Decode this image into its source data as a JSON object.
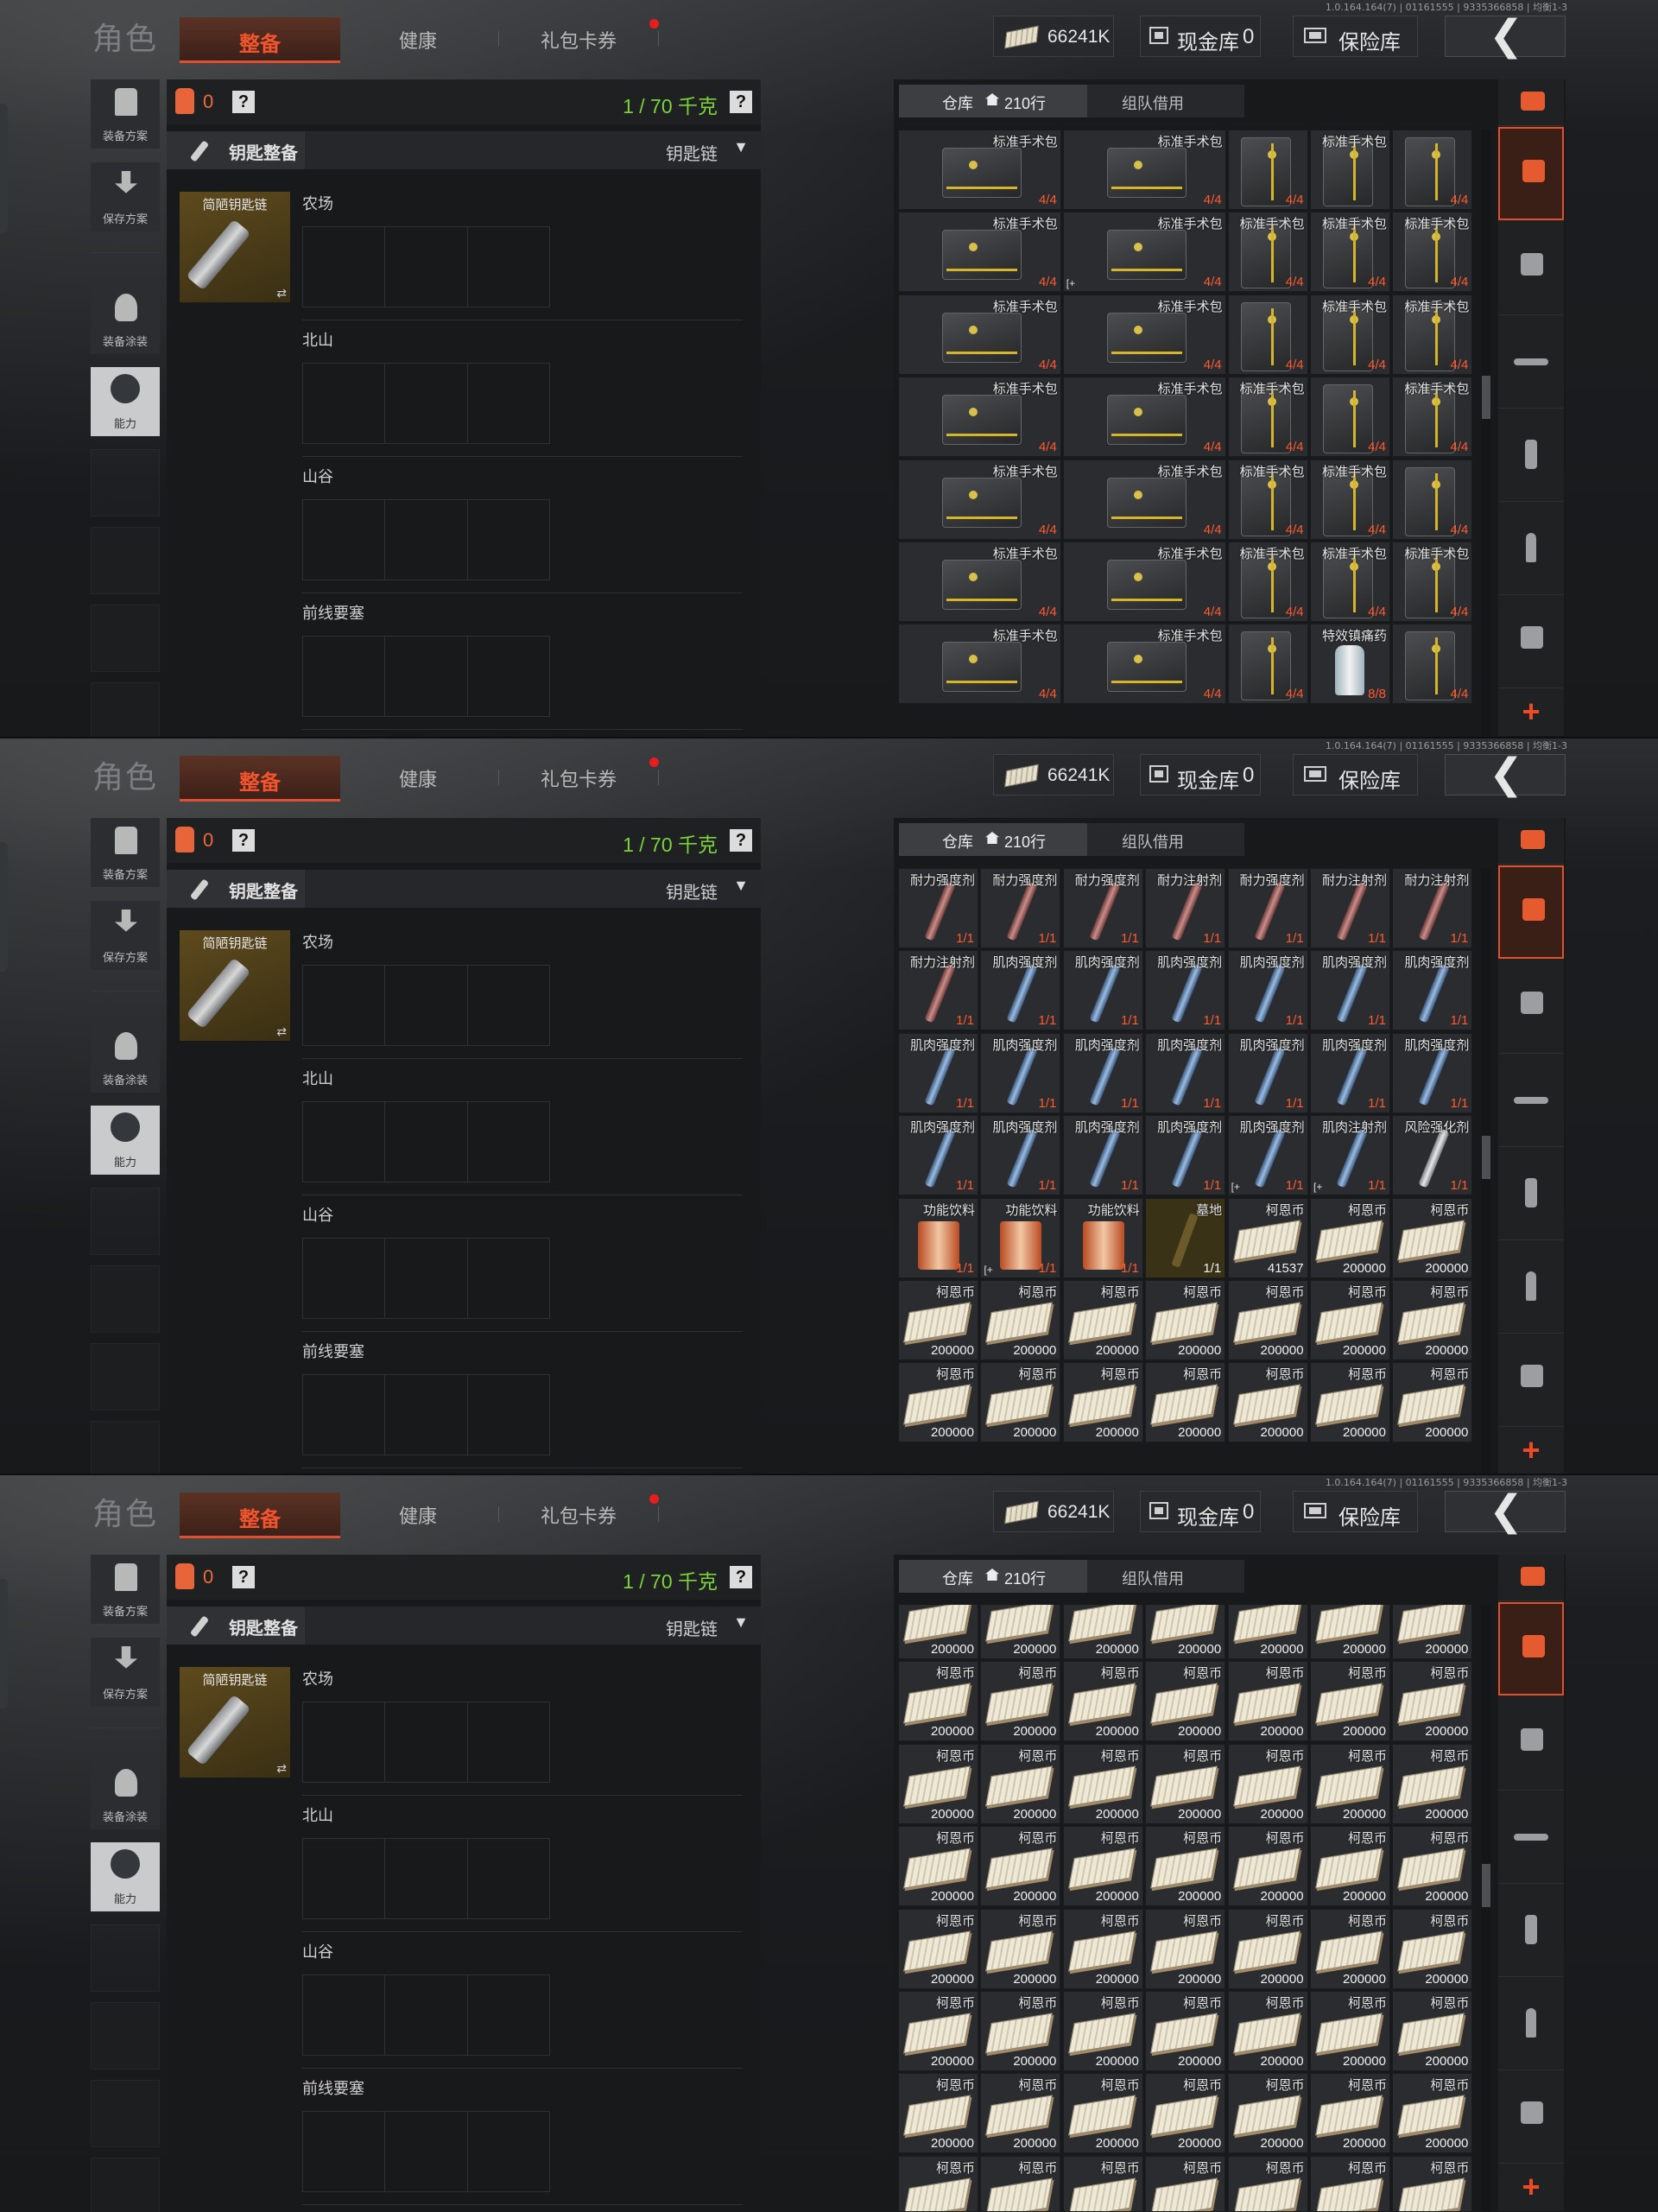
{
  "version": "1.0.164.164(7) | 01161555 | 9335366858 | 均衡1-3",
  "title": "角色",
  "tabs": {
    "active": "整备",
    "health": "健康",
    "gift": "礼包卡券"
  },
  "currency": {
    "amount": "66241K",
    "cash_vault_label": "现金库",
    "cash_vault_value": "0",
    "safe_label": "保险库"
  },
  "side": {
    "plan": "装备方案",
    "save": "保存方案",
    "paint": "装备涂装",
    "ability": "能力"
  },
  "panel": {
    "count": "0",
    "qmark": "?",
    "weight": "1 / 70 千克",
    "key_title": "钥匙整备",
    "key_select": "钥匙链",
    "keychain_name": "简陋钥匙链",
    "swap": "⇄",
    "sections": [
      "农场",
      "北山",
      "山谷",
      "前线要塞"
    ]
  },
  "inventory": {
    "tab_warehouse": "仓库",
    "rows": "210行",
    "tab_team": "组队借用",
    "plus": "+"
  },
  "screens": [
    {
      "grid": [
        [
          {
            "kind": "bag",
            "name": "标准手术包",
            "count": "4/4"
          },
          {
            "kind": "bag",
            "name": "标准手术包",
            "count": "4/4"
          },
          {
            "kind": "bagv",
            "name": "",
            "count": "4/4"
          },
          {
            "kind": "bagv",
            "name": "标准手术包",
            "count": ""
          },
          {
            "kind": "bagv",
            "name": "",
            "count": "4/4"
          }
        ],
        [
          {
            "kind": "bag",
            "name": "标准手术包",
            "count": "4/4"
          },
          {
            "kind": "bag",
            "name": "标准手术包",
            "count": "4/4",
            "mark": "[+"
          },
          {
            "kind": "bagv",
            "name": "标准手术包",
            "count": "4/4"
          },
          {
            "kind": "bagv",
            "name": "标准手术包",
            "count": "4/4"
          },
          {
            "kind": "bagv",
            "name": "标准手术包",
            "count": "4/4"
          }
        ],
        [
          {
            "kind": "bag",
            "name": "标准手术包",
            "count": "4/4"
          },
          {
            "kind": "bag",
            "name": "标准手术包",
            "count": "4/4"
          },
          {
            "kind": "bagv",
            "name": "",
            "count": "4/4"
          },
          {
            "kind": "bagv",
            "name": "标准手术包",
            "count": "4/4"
          },
          {
            "kind": "bagv",
            "name": "标准手术包",
            "count": "4/4"
          }
        ],
        [
          {
            "kind": "bag",
            "name": "标准手术包",
            "count": "4/4"
          },
          {
            "kind": "bag",
            "name": "标准手术包",
            "count": "4/4"
          },
          {
            "kind": "bagv",
            "name": "标准手术包",
            "count": "4/4"
          },
          {
            "kind": "bagv",
            "name": "",
            "count": "4/4"
          },
          {
            "kind": "bagv",
            "name": "标准手术包",
            "count": "4/4"
          }
        ],
        [
          {
            "kind": "bag",
            "name": "标准手术包",
            "count": "4/4"
          },
          {
            "kind": "bag",
            "name": "标准手术包",
            "count": "4/4"
          },
          {
            "kind": "bagv",
            "name": "标准手术包",
            "count": "4/4"
          },
          {
            "kind": "bagv",
            "name": "标准手术包",
            "count": "4/4"
          },
          {
            "kind": "bagv",
            "name": "",
            "count": "4/4"
          }
        ],
        [
          {
            "kind": "bag",
            "name": "标准手术包",
            "count": "4/4"
          },
          {
            "kind": "bag",
            "name": "标准手术包",
            "count": "4/4"
          },
          {
            "kind": "bagv",
            "name": "标准手术包",
            "count": "4/4"
          },
          {
            "kind": "bagv",
            "name": "标准手术包",
            "count": "4/4"
          },
          {
            "kind": "bagv",
            "name": "标准手术包",
            "count": "4/4"
          }
        ],
        [
          {
            "kind": "bag",
            "name": "标准手术包",
            "count": "4/4"
          },
          {
            "kind": "bag",
            "name": "标准手术包",
            "count": "4/4"
          },
          {
            "kind": "bagv",
            "name": "",
            "count": "4/4"
          },
          {
            "kind": "bottle",
            "name": "特效镇痛药",
            "count": "8/8"
          },
          {
            "kind": "bagv",
            "name": "",
            "count": "4/4"
          }
        ]
      ]
    },
    {
      "grid": [
        [
          {
            "kind": "syr-red",
            "name": "耐力强度剂",
            "count": "1/1"
          },
          {
            "kind": "syr-red",
            "name": "耐力强度剂",
            "count": "1/1"
          },
          {
            "kind": "syr-red",
            "name": "耐力强度剂",
            "count": "1/1"
          },
          {
            "kind": "syr-red",
            "name": "耐力注射剂",
            "count": "1/1"
          },
          {
            "kind": "syr-red",
            "name": "耐力强度剂",
            "count": "1/1"
          },
          {
            "kind": "syr-red",
            "name": "耐力注射剂",
            "count": "1/1"
          },
          {
            "kind": "syr-red",
            "name": "耐力注射剂",
            "count": "1/1"
          }
        ],
        [
          {
            "kind": "syr-red",
            "name": "耐力注射剂",
            "count": "1/1"
          },
          {
            "kind": "syr-blue",
            "name": "肌肉强度剂",
            "count": "1/1"
          },
          {
            "kind": "syr-blue",
            "name": "肌肉强度剂",
            "count": "1/1"
          },
          {
            "kind": "syr-blue",
            "name": "肌肉强度剂",
            "count": "1/1"
          },
          {
            "kind": "syr-blue",
            "name": "肌肉强度剂",
            "count": "1/1"
          },
          {
            "kind": "syr-blue",
            "name": "肌肉强度剂",
            "count": "1/1"
          },
          {
            "kind": "syr-blue",
            "name": "肌肉强度剂",
            "count": "1/1"
          }
        ],
        [
          {
            "kind": "syr-blue",
            "name": "肌肉强度剂",
            "count": "1/1"
          },
          {
            "kind": "syr-blue",
            "name": "肌肉强度剂",
            "count": "1/1"
          },
          {
            "kind": "syr-blue",
            "name": "肌肉强度剂",
            "count": "1/1"
          },
          {
            "kind": "syr-blue",
            "name": "肌肉强度剂",
            "count": "1/1"
          },
          {
            "kind": "syr-blue",
            "name": "肌肉强度剂",
            "count": "1/1"
          },
          {
            "kind": "syr-blue",
            "name": "肌肉强度剂",
            "count": "1/1"
          },
          {
            "kind": "syr-blue",
            "name": "肌肉强度剂",
            "count": "1/1"
          }
        ],
        [
          {
            "kind": "syr-blue",
            "name": "肌肉强度剂",
            "count": "1/1"
          },
          {
            "kind": "syr-blue",
            "name": "肌肉强度剂",
            "count": "1/1"
          },
          {
            "kind": "syr-blue",
            "name": "肌肉强度剂",
            "count": "1/1"
          },
          {
            "kind": "syr-blue",
            "name": "肌肉强度剂",
            "count": "1/1"
          },
          {
            "kind": "syr-blue",
            "name": "肌肉强度剂",
            "count": "1/1",
            "mark": "[+"
          },
          {
            "kind": "syr-blue",
            "name": "肌肉注射剂",
            "count": "1/1",
            "mark": "[+"
          },
          {
            "kind": "syr-silver",
            "name": "风险强化剂",
            "count": "1/1"
          }
        ],
        [
          {
            "kind": "can",
            "name": "功能饮料",
            "count": "1/1"
          },
          {
            "kind": "can",
            "name": "功能饮料",
            "count": "1/1",
            "mark": "[+"
          },
          {
            "kind": "can",
            "name": "功能饮料",
            "count": "1/1"
          },
          {
            "kind": "shovel",
            "name": "墓地",
            "count": "1/1",
            "white": true,
            "gold": true
          },
          {
            "kind": "cash",
            "name": "柯恩币",
            "count": "41537",
            "white": true
          },
          {
            "kind": "cash",
            "name": "柯恩币",
            "count": "200000",
            "white": true
          },
          {
            "kind": "cash",
            "name": "柯恩币",
            "count": "200000",
            "white": true
          }
        ],
        [
          {
            "kind": "cash",
            "name": "柯恩币",
            "count": "200000",
            "white": true
          },
          {
            "kind": "cash",
            "name": "柯恩币",
            "count": "200000",
            "white": true
          },
          {
            "kind": "cash",
            "name": "柯恩币",
            "count": "200000",
            "white": true
          },
          {
            "kind": "cash",
            "name": "柯恩币",
            "count": "200000",
            "white": true
          },
          {
            "kind": "cash",
            "name": "柯恩币",
            "count": "200000",
            "white": true
          },
          {
            "kind": "cash",
            "name": "柯恩币",
            "count": "200000",
            "white": true
          },
          {
            "kind": "cash",
            "name": "柯恩币",
            "count": "200000",
            "white": true
          }
        ],
        [
          {
            "kind": "cash",
            "name": "柯恩币",
            "count": "200000",
            "white": true
          },
          {
            "kind": "cash",
            "name": "柯恩币",
            "count": "200000",
            "white": true
          },
          {
            "kind": "cash",
            "name": "柯恩币",
            "count": "200000",
            "white": true
          },
          {
            "kind": "cash",
            "name": "柯恩币",
            "count": "200000",
            "white": true
          },
          {
            "kind": "cash",
            "name": "柯恩币",
            "count": "200000",
            "white": true
          },
          {
            "kind": "cash",
            "name": "柯恩币",
            "count": "200000",
            "white": true
          },
          {
            "kind": "cash",
            "name": "柯恩币",
            "count": "200000",
            "white": true
          }
        ]
      ]
    },
    {
      "grid": [
        [
          {
            "kind": "cash",
            "name": "",
            "count": "200000",
            "white": true
          },
          {
            "kind": "cash",
            "name": "",
            "count": "200000",
            "white": true
          },
          {
            "kind": "cash",
            "name": "",
            "count": "200000",
            "white": true
          },
          {
            "kind": "cash",
            "name": "",
            "count": "200000",
            "white": true
          },
          {
            "kind": "cash",
            "name": "",
            "count": "200000",
            "white": true
          },
          {
            "kind": "cash",
            "name": "",
            "count": "200000",
            "white": true
          },
          {
            "kind": "cash",
            "name": "",
            "count": "200000",
            "white": true
          }
        ],
        [
          {
            "kind": "cash",
            "name": "柯恩币",
            "count": "200000",
            "white": true
          },
          {
            "kind": "cash",
            "name": "柯恩币",
            "count": "200000",
            "white": true
          },
          {
            "kind": "cash",
            "name": "柯恩币",
            "count": "200000",
            "white": true
          },
          {
            "kind": "cash",
            "name": "柯恩币",
            "count": "200000",
            "white": true
          },
          {
            "kind": "cash",
            "name": "柯恩币",
            "count": "200000",
            "white": true
          },
          {
            "kind": "cash",
            "name": "柯恩币",
            "count": "200000",
            "white": true
          },
          {
            "kind": "cash",
            "name": "柯恩币",
            "count": "200000",
            "white": true
          }
        ],
        [
          {
            "kind": "cash",
            "name": "柯恩币",
            "count": "200000",
            "white": true
          },
          {
            "kind": "cash",
            "name": "柯恩币",
            "count": "200000",
            "white": true
          },
          {
            "kind": "cash",
            "name": "柯恩币",
            "count": "200000",
            "white": true
          },
          {
            "kind": "cash",
            "name": "柯恩币",
            "count": "200000",
            "white": true
          },
          {
            "kind": "cash",
            "name": "柯恩币",
            "count": "200000",
            "white": true
          },
          {
            "kind": "cash",
            "name": "柯恩币",
            "count": "200000",
            "white": true
          },
          {
            "kind": "cash",
            "name": "柯恩币",
            "count": "200000",
            "white": true
          }
        ],
        [
          {
            "kind": "cash",
            "name": "柯恩币",
            "count": "200000",
            "white": true
          },
          {
            "kind": "cash",
            "name": "柯恩币",
            "count": "200000",
            "white": true
          },
          {
            "kind": "cash",
            "name": "柯恩币",
            "count": "200000",
            "white": true
          },
          {
            "kind": "cash",
            "name": "柯恩币",
            "count": "200000",
            "white": true
          },
          {
            "kind": "cash",
            "name": "柯恩币",
            "count": "200000",
            "white": true
          },
          {
            "kind": "cash",
            "name": "柯恩币",
            "count": "200000",
            "white": true
          },
          {
            "kind": "cash",
            "name": "柯恩币",
            "count": "200000",
            "white": true
          }
        ],
        [
          {
            "kind": "cash",
            "name": "柯恩币",
            "count": "200000",
            "white": true
          },
          {
            "kind": "cash",
            "name": "柯恩币",
            "count": "200000",
            "white": true
          },
          {
            "kind": "cash",
            "name": "柯恩币",
            "count": "200000",
            "white": true
          },
          {
            "kind": "cash",
            "name": "柯恩币",
            "count": "200000",
            "white": true
          },
          {
            "kind": "cash",
            "name": "柯恩币",
            "count": "200000",
            "white": true
          },
          {
            "kind": "cash",
            "name": "柯恩币",
            "count": "200000",
            "white": true
          },
          {
            "kind": "cash",
            "name": "柯恩币",
            "count": "200000",
            "white": true
          }
        ],
        [
          {
            "kind": "cash",
            "name": "柯恩币",
            "count": "200000",
            "white": true
          },
          {
            "kind": "cash",
            "name": "柯恩币",
            "count": "200000",
            "white": true
          },
          {
            "kind": "cash",
            "name": "柯恩币",
            "count": "200000",
            "white": true
          },
          {
            "kind": "cash",
            "name": "柯恩币",
            "count": "200000",
            "white": true
          },
          {
            "kind": "cash",
            "name": "柯恩币",
            "count": "200000",
            "white": true
          },
          {
            "kind": "cash",
            "name": "柯恩币",
            "count": "200000",
            "white": true
          },
          {
            "kind": "cash",
            "name": "柯恩币",
            "count": "200000",
            "white": true
          }
        ],
        [
          {
            "kind": "cash",
            "name": "柯恩币",
            "count": "200000",
            "white": true
          },
          {
            "kind": "cash",
            "name": "柯恩币",
            "count": "200000",
            "white": true
          },
          {
            "kind": "cash",
            "name": "柯恩币",
            "count": "200000",
            "white": true
          },
          {
            "kind": "cash",
            "name": "柯恩币",
            "count": "200000",
            "white": true
          },
          {
            "kind": "cash",
            "name": "柯恩币",
            "count": "200000",
            "white": true
          },
          {
            "kind": "cash",
            "name": "柯恩币",
            "count": "200000",
            "white": true
          },
          {
            "kind": "cash",
            "name": "柯恩币",
            "count": "200000",
            "white": true
          }
        ],
        [
          {
            "kind": "cash",
            "name": "柯恩币",
            "count": "",
            "white": true
          },
          {
            "kind": "cash",
            "name": "柯恩币",
            "count": "",
            "white": true
          },
          {
            "kind": "cash",
            "name": "柯恩币",
            "count": "",
            "white": true
          },
          {
            "kind": "cash",
            "name": "柯恩币",
            "count": "",
            "white": true
          },
          {
            "kind": "cash",
            "name": "柯恩币",
            "count": "",
            "white": true
          },
          {
            "kind": "cash",
            "name": "柯恩币",
            "count": "",
            "white": true
          },
          {
            "kind": "cash",
            "name": "柯恩币",
            "count": "",
            "white": true
          }
        ]
      ]
    }
  ]
}
